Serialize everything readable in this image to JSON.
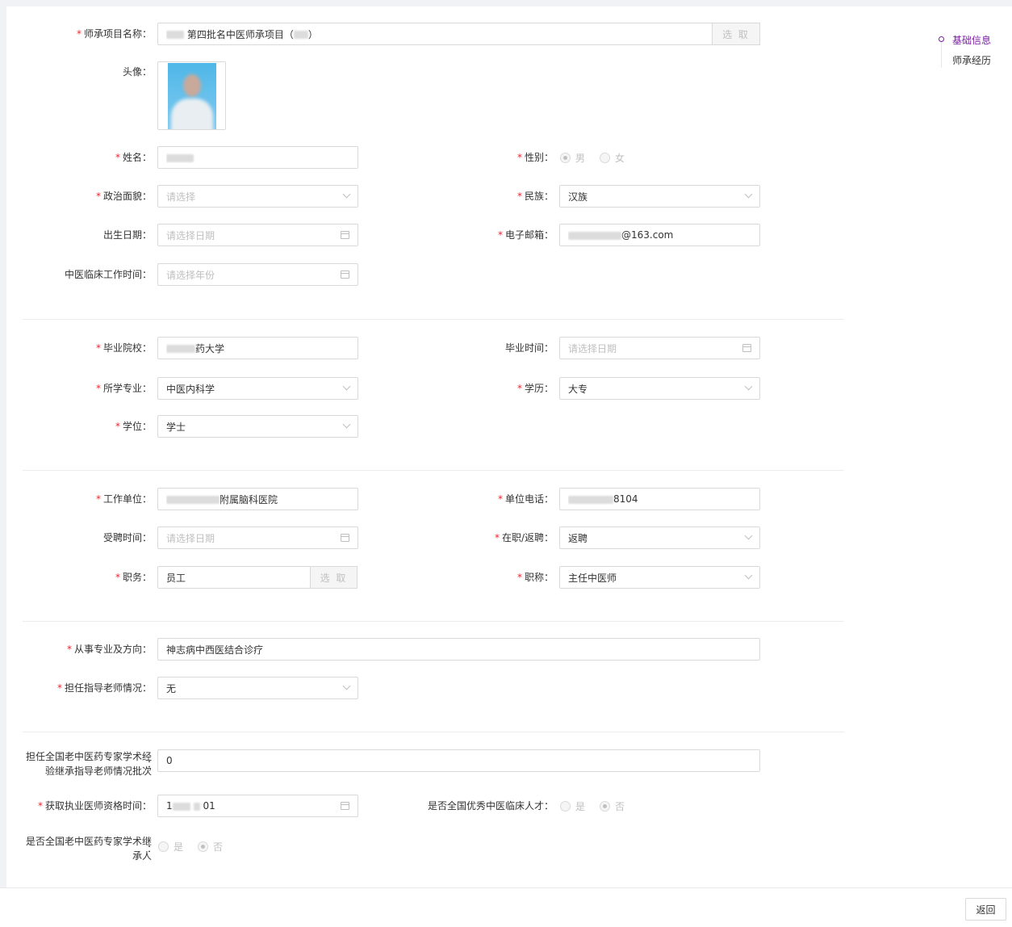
{
  "anchor_nav": {
    "items": [
      {
        "label": "基础信息",
        "active": true
      },
      {
        "label": "师承经历",
        "active": false
      }
    ]
  },
  "fields": {
    "project": {
      "label": "师承项目名称",
      "value": "第四批名中医师承项目（",
      "value_suffix": "）",
      "button": "选 取"
    },
    "avatar": {
      "label": "头像"
    },
    "name": {
      "label": "姓名",
      "value": ""
    },
    "gender": {
      "label": "性别",
      "options": [
        "男",
        "女"
      ],
      "selected": "男"
    },
    "political": {
      "label": "政治面貌",
      "placeholder": "请选择"
    },
    "ethnicity": {
      "label": "民族",
      "value": "汉族"
    },
    "birth_date": {
      "label": "出生日期",
      "placeholder": "请选择日期"
    },
    "email": {
      "label": "电子邮箱",
      "value": "@163.com"
    },
    "tcm_clinical_time": {
      "label": "中医临床工作时间",
      "placeholder": "请选择年份"
    },
    "school": {
      "label": "毕业院校",
      "value": "药大学"
    },
    "grad_time": {
      "label": "毕业时间",
      "placeholder": "请选择日期"
    },
    "major": {
      "label": "所学专业",
      "value": "中医内科学"
    },
    "education": {
      "label": "学历",
      "value": "大专"
    },
    "degree": {
      "label": "学位",
      "value": "学士"
    },
    "work_unit": {
      "label": "工作单位",
      "value": "附属脑科医院"
    },
    "unit_phone": {
      "label": "单位电话",
      "value": "8104"
    },
    "hire_time": {
      "label": "受聘时间",
      "placeholder": "请选择日期"
    },
    "job_status": {
      "label": "在职/返聘",
      "value": "返聘"
    },
    "position": {
      "label": "职务",
      "value": "员工",
      "button": "选 取"
    },
    "title": {
      "label": "职称",
      "value": "主任中医师"
    },
    "specialty": {
      "label": "从事专业及方向",
      "value": "神志病中西医结合诊疗"
    },
    "mentor_status": {
      "label": "担任指导老师情况",
      "value": "无"
    },
    "national_mentor_batch": {
      "label": "担任全国老中医药专家学术经验继承指导老师情况批次",
      "value": "0"
    },
    "license_time": {
      "label": "获取执业医师资格时间",
      "value": "01"
    },
    "national_talent": {
      "label": "是否全国优秀中医临床人才",
      "options": [
        "是",
        "否"
      ],
      "selected": "否"
    },
    "national_inheritor": {
      "label": "是否全国老中医药专家学术继承人",
      "options": [
        "是",
        "否"
      ],
      "selected": "否"
    }
  },
  "footer": {
    "back_label": "返回"
  },
  "colors": {
    "accent": "#7b1fa2",
    "required": "#f5222d",
    "border": "#d9d9d9"
  }
}
